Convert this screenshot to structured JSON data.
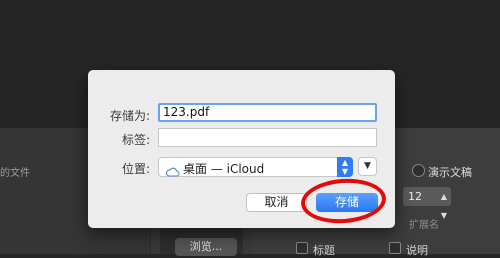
{
  "background": {
    "left_label": "的文件",
    "browse_button": "浏览...",
    "radio_option": "演示文稿",
    "size_value": "12",
    "extension_label": "扩展名",
    "checkbox_title": "标题",
    "checkbox_notes": "说明"
  },
  "dialog": {
    "save_as_label": "存储为:",
    "save_as_value": "123.pdf",
    "tags_label": "标签:",
    "tags_value": "",
    "location_label": "位置:",
    "location_value": "桌面 — iCloud",
    "cancel_label": "取消",
    "save_label": "存储"
  },
  "colors": {
    "accent": "#2f7cf6",
    "highlight": "#e40a0a"
  }
}
